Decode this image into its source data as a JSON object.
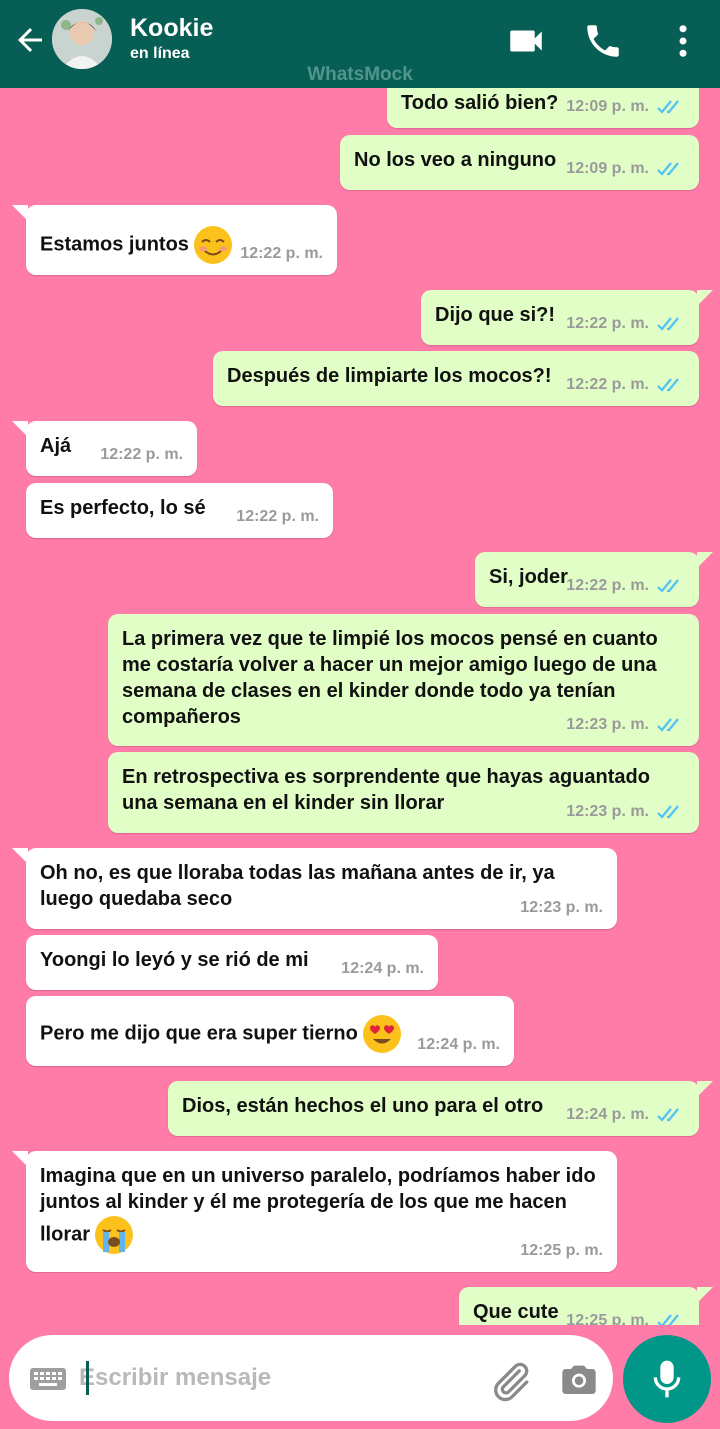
{
  "header": {
    "contact_name": "Kookie",
    "status": "en línea",
    "watermark": "WhatsMock"
  },
  "messages": [
    {
      "dir": "out",
      "text": "Todo salió bien?",
      "time": "12:09 p. m."
    },
    {
      "dir": "out",
      "text": "No los veo a ninguno",
      "time": "12:09 p. m."
    },
    {
      "dir": "in",
      "text": "Estamos juntos",
      "time": "12:22 p. m.",
      "emoji": "smiling-blush-emoji"
    },
    {
      "dir": "out",
      "text": "Dijo que si?!",
      "time": "12:22 p. m."
    },
    {
      "dir": "out",
      "text": "Después de limpiarte los mocos?!",
      "time": "12:22 p. m."
    },
    {
      "dir": "in",
      "text": "Ajá",
      "time": "12:22 p. m."
    },
    {
      "dir": "in",
      "text": "Es perfecto, lo sé",
      "time": "12:22 p. m."
    },
    {
      "dir": "out",
      "text": "Si, joder",
      "time": "12:22 p. m."
    },
    {
      "dir": "out",
      "text": "La primera vez que te limpié los mocos pensé en cuanto me costaría volver a hacer un mejor amigo luego de una semana de clases en el kinder donde todo ya tenían compañeros",
      "time": "12:23 p. m."
    },
    {
      "dir": "out",
      "text": "En retrospectiva es sorprendente que hayas aguantado una semana en el kinder sin llorar",
      "time": "12:23 p. m."
    },
    {
      "dir": "in",
      "text": "Oh no, es que lloraba todas las mañana antes de ir, ya luego quedaba seco",
      "time": "12:23 p. m."
    },
    {
      "dir": "in",
      "text": "Yoongi lo leyó y se rió de mi",
      "time": "12:24 p. m."
    },
    {
      "dir": "in",
      "text": "Pero me dijo que era super tierno",
      "time": "12:24 p. m.",
      "emoji": "heart-eyes-emoji"
    },
    {
      "dir": "out",
      "text": "Dios, están hechos el uno para el otro",
      "time": "12:24 p. m."
    },
    {
      "dir": "in",
      "text": "Imagina que en un universo paralelo, podríamos haber ido juntos al kinder y él me protegería de los que me hacen llorar",
      "time": "12:25 p. m.",
      "emoji": "crying-emoji"
    },
    {
      "dir": "out",
      "text": "Que cute",
      "time": "12:25 p. m."
    }
  ],
  "composer": {
    "placeholder": "Escribir mensaje"
  },
  "colors": {
    "header": "#075e54",
    "chat_background": "#ff7ba8",
    "outgoing_bubble": "#e1fec6",
    "incoming_bubble": "#ffffff",
    "read_ticks": "#4fc3f7",
    "mic_button": "#009688"
  },
  "icons": [
    "back-arrow-icon",
    "video-call-icon",
    "phone-icon",
    "more-options-icon",
    "double-check-icon",
    "keyboard-icon",
    "attach-icon",
    "camera-icon",
    "mic-icon"
  ]
}
